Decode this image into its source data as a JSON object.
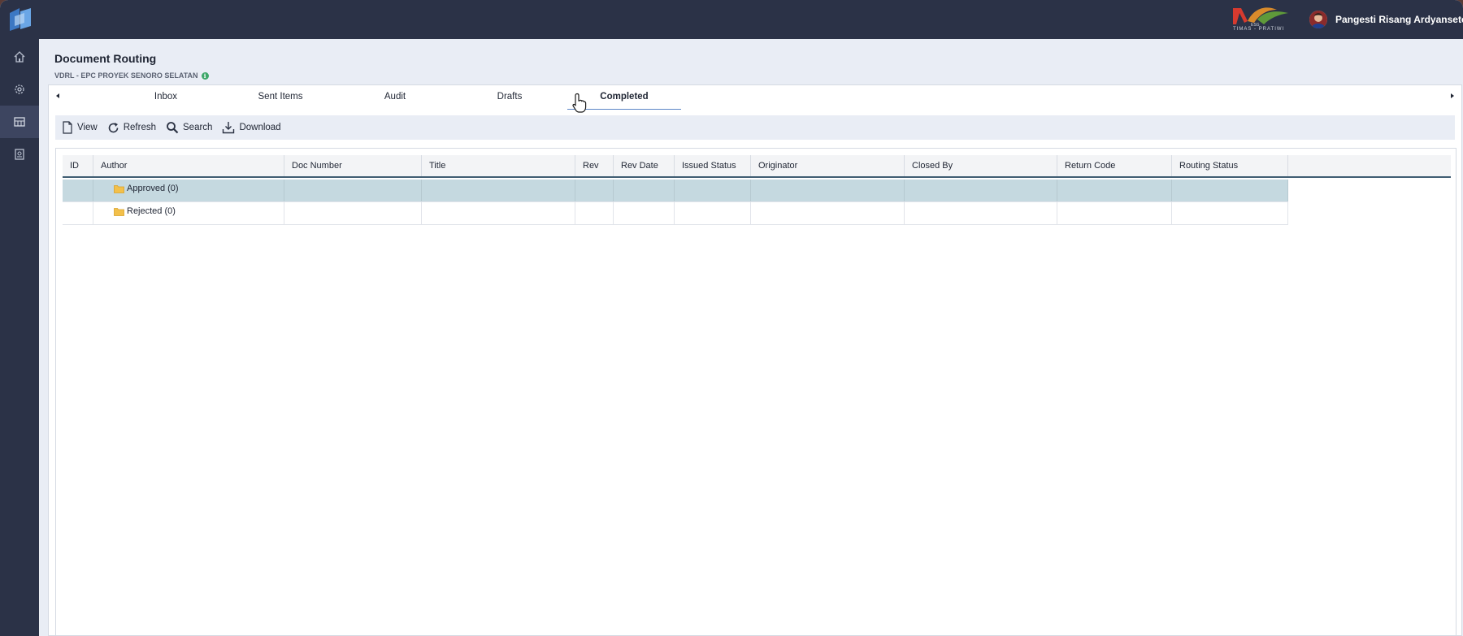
{
  "header": {
    "app_logo_icon": "app-logo-icon",
    "brand_logo_text": "TIMAS - PRATIWI",
    "user_name": "Pangesti Risang Ardyanseto"
  },
  "sidebar": {
    "items": [
      {
        "icon": "home-icon",
        "active": false
      },
      {
        "icon": "gear-icon",
        "active": false
      },
      {
        "icon": "dashboard-icon",
        "active": true
      },
      {
        "icon": "document-icon",
        "active": false
      }
    ]
  },
  "page": {
    "title": "Document Routing",
    "subtitle": "VDRL - EPC PROYEK SENORO SELATAN"
  },
  "tabs": [
    {
      "label": "Inbox",
      "active": false
    },
    {
      "label": "Sent Items",
      "active": false
    },
    {
      "label": "Audit",
      "active": false
    },
    {
      "label": "Drafts",
      "active": false
    },
    {
      "label": "Completed",
      "active": true
    }
  ],
  "toolbar": {
    "view_label": "View",
    "refresh_label": "Refresh",
    "search_label": "Search",
    "download_label": "Download"
  },
  "grid": {
    "columns": [
      "ID",
      "Author",
      "Doc Number",
      "Title",
      "Rev",
      "Rev Date",
      "Issued Status",
      "Originator",
      "Closed By",
      "Return Code",
      "Routing Status"
    ],
    "groups": [
      {
        "label": "Approved (0)",
        "selected": true
      },
      {
        "label": "Rejected (0)",
        "selected": false
      }
    ]
  },
  "colors": {
    "topbar": "#2b3247",
    "accent": "#5b86c6",
    "selected_row": "#c5d9e0",
    "folder": "#f3c04a"
  }
}
